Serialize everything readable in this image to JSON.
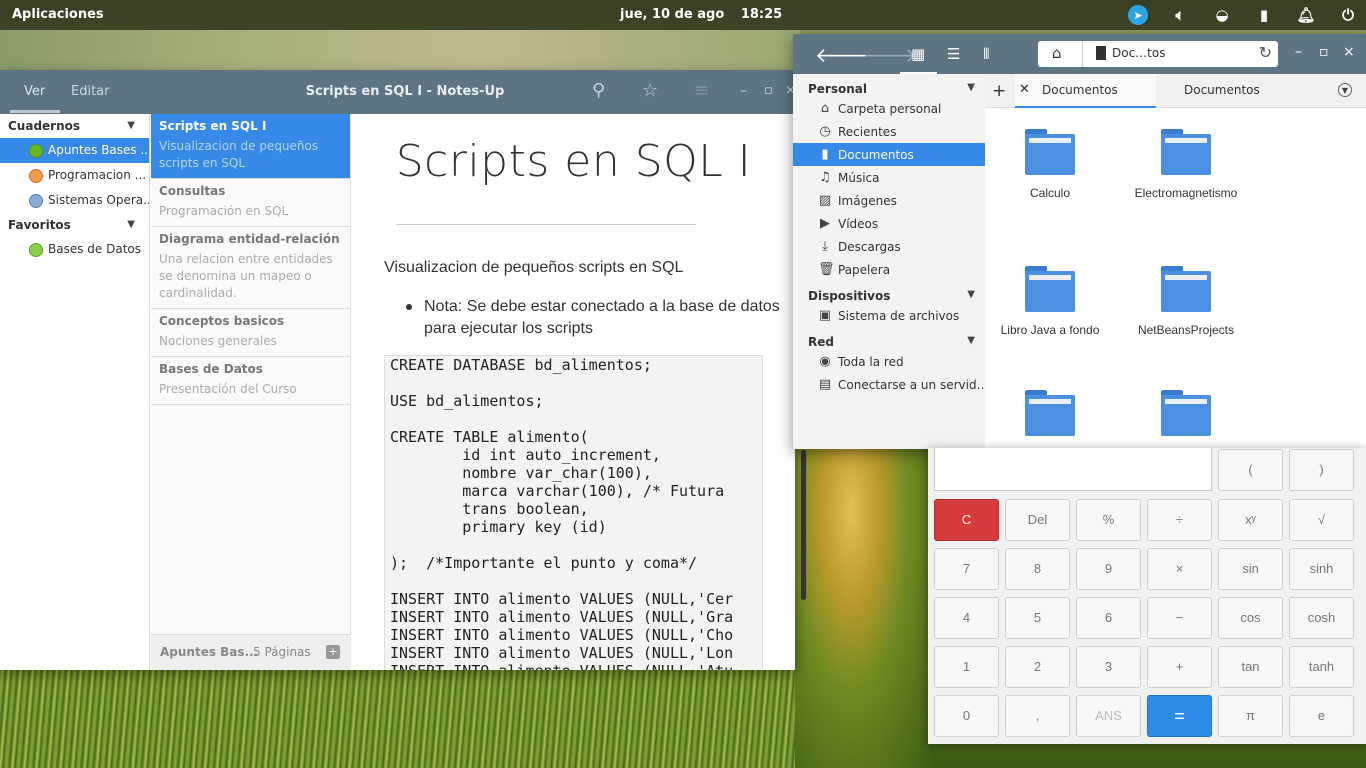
{
  "panel": {
    "apps_label": "Aplicaciones",
    "date": "jue, 10 de ago",
    "time": "18:25"
  },
  "notes": {
    "tab_view": "Ver",
    "tab_edit": "Editar",
    "window_title": "Scripts en SQL I - Notes-Up",
    "sidebar": {
      "notebooks_header": "Cuadernos",
      "notebooks": [
        {
          "label": "Apuntes Bases ...",
          "color": "#68b723"
        },
        {
          "label": "Programacion ...",
          "color": "#f37329"
        },
        {
          "label": "Sistemas Opera...",
          "color": "#7a9fcf"
        }
      ],
      "favorites_header": "Favoritos",
      "favorites": [
        {
          "label": "Bases de Datos",
          "color": "#68b723"
        }
      ]
    },
    "pages": [
      {
        "title": "Scripts en SQL I",
        "desc": "Visualizacion de pequeños scripts en SQL"
      },
      {
        "title": "Consultas",
        "desc": "Programación en SQL"
      },
      {
        "title": "Diagrama entidad-relación",
        "desc": "Una relacion entre entidades se denomina un mapeo o cardinalidad."
      },
      {
        "title": "Conceptos basicos",
        "desc": "Nociones generales"
      },
      {
        "title": "Bases de Datos",
        "desc": "Presentación del Curso"
      }
    ],
    "footer_notebook": "Apuntes Bas...",
    "footer_count": "5 Páginas",
    "content": {
      "heading": "Scripts en SQL I",
      "lead": "Visualizacion de pequeños scripts en SQL",
      "bullet": "Nota: Se debe estar conectado a la base de datos para ejecutar los scripts",
      "code": "CREATE DATABASE bd_alimentos;\n\nUSE bd_alimentos;\n\nCREATE TABLE alimento(\n        id int auto_increment,\n        nombre var_char(100),\n        marca varchar(100), /* Futura\n        trans boolean,\n        primary key (id)\n\n);  /*Importante el punto y coma*/\n\nINSERT INTO alimento VALUES (NULL,'Cer\nINSERT INTO alimento VALUES (NULL,'Gra\nINSERT INTO alimento VALUES (NULL,'Cho\nINSERT INTO alimento VALUES (NULL,'Lon\nINSERT INTO alimento VALUES (NULL,'Atu"
    }
  },
  "files": {
    "path_label": "Doc…tos",
    "personal_header": "Personal",
    "personal": [
      {
        "label": "Carpeta personal",
        "icon": "home-icon"
      },
      {
        "label": "Recientes",
        "icon": "clock-icon"
      },
      {
        "label": "Documentos",
        "icon": "document-icon"
      },
      {
        "label": "Música",
        "icon": "music-icon"
      },
      {
        "label": "Imágenes",
        "icon": "image-icon"
      },
      {
        "label": "Vídeos",
        "icon": "video-icon"
      },
      {
        "label": "Descargas",
        "icon": "download-icon"
      },
      {
        "label": "Papelera",
        "icon": "trash-icon"
      }
    ],
    "devices_header": "Dispositivos",
    "devices": [
      {
        "label": "Sistema de archivos",
        "icon": "drive-icon"
      }
    ],
    "network_header": "Red",
    "network": [
      {
        "label": "Toda la red",
        "icon": "network-icon"
      },
      {
        "label": "Conectarse a un servid…",
        "icon": "server-icon"
      }
    ],
    "tab_active": "Documentos",
    "tab_other": "Documentos",
    "folders": [
      "Calculo",
      "Electromagnetismo",
      "Libro Java a fondo",
      "NetBeansProjects",
      "",
      ""
    ]
  },
  "calculator": {
    "keys": [
      [
        "(",
        ")"
      ],
      [
        "C",
        "Del",
        "%",
        "÷",
        "xʸ",
        "√"
      ],
      [
        "7",
        "8",
        "9",
        "×",
        "sin",
        "sinh"
      ],
      [
        "4",
        "5",
        "6",
        "−",
        "cos",
        "cosh"
      ],
      [
        "1",
        "2",
        "3",
        "+",
        "tan",
        "tanh"
      ],
      [
        "0",
        ",",
        "ANS",
        "=",
        "π",
        "e"
      ]
    ]
  }
}
